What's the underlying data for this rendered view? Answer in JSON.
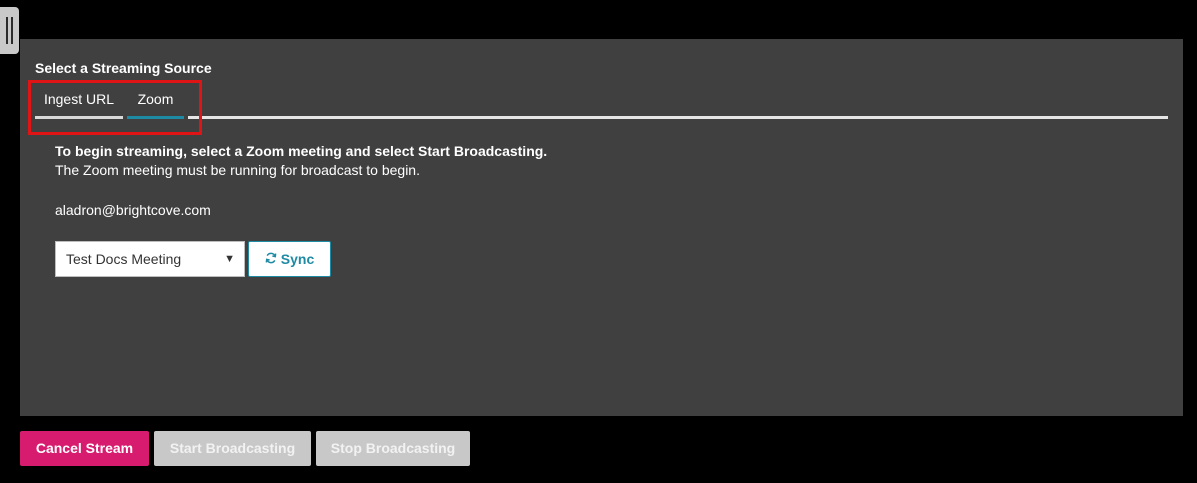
{
  "panel": {
    "title": "Select a Streaming Source",
    "tabs": [
      {
        "label": "Ingest URL",
        "active": false
      },
      {
        "label": "Zoom",
        "active": true
      }
    ]
  },
  "zoom": {
    "instructions_bold": "To begin streaming, select a Zoom meeting and select Start Broadcasting.",
    "instructions_text": "The Zoom meeting must be running for broadcast to begin.",
    "account_email": "aladron@brightcove.com",
    "meeting_select": {
      "selected": "Test Docs Meeting"
    },
    "sync_label": "Sync",
    "sync_icon": "refresh-icon"
  },
  "actions": {
    "cancel_label": "Cancel Stream",
    "start_label": "Start Broadcasting",
    "stop_label": "Stop Broadcasting"
  },
  "colors": {
    "panel_bg": "#404040",
    "accent_teal": "#1f8aa4",
    "cancel_magenta": "#d71b6f",
    "disabled_gray": "#c8c8c8",
    "highlight_red": "#e01414"
  }
}
